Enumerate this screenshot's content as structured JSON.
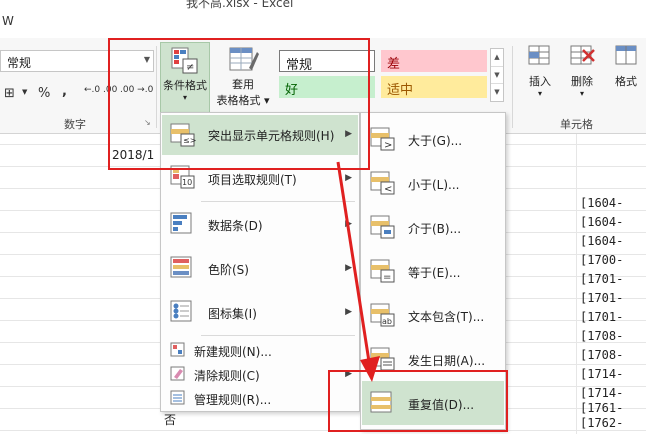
{
  "window": {
    "title_partial": "我不高.xlsx - Excel",
    "partial_tab": "W"
  },
  "ribbon": {
    "number_format_value": "常规",
    "number_buttons": {
      "percent": "%",
      "comma": ",",
      "inc_decimal": "←.0 .00",
      "dec_decimal": ".00 →.0"
    },
    "number_group_label": "数字",
    "cond_format": {
      "line1": "条件格式",
      "line2": "▾"
    },
    "table_format": {
      "line1": "套用",
      "line2": "表格格式 ▾"
    },
    "styles": {
      "normal": "常规",
      "bad": "差",
      "good": "好",
      "neutral": "适中"
    },
    "cells": {
      "insert": "插入",
      "delete": "删除",
      "format": "格式"
    },
    "cells_group_label": "单元格"
  },
  "sheet": {
    "date_cell": "2018/1",
    "zi_cell": "否",
    "codes": [
      "[1604-",
      "[1604-",
      "[1604-",
      "[1700-",
      "[1701-",
      "[1701-",
      "[1701-",
      "[1708-",
      "[1708-",
      "[1714-",
      "[1714-",
      "[1761-",
      "[1762-"
    ]
  },
  "main_menu": {
    "items": [
      {
        "label": "突出显示单元格规则(H)",
        "has_sub": true,
        "highlighted": true
      },
      {
        "label": "项目选取规则(T)",
        "has_sub": true
      },
      {
        "label": "数据条(D)",
        "has_sub": true
      },
      {
        "label": "色阶(S)",
        "has_sub": true
      },
      {
        "label": "图标集(I)",
        "has_sub": true
      },
      {
        "label": "新建规则(N)..."
      },
      {
        "label": "清除规则(C)",
        "has_sub": true
      },
      {
        "label": "管理规则(R)..."
      }
    ],
    "sub_arrow": "▶"
  },
  "sub_menu": {
    "items": [
      {
        "label": "大于(G)..."
      },
      {
        "label": "小于(L)..."
      },
      {
        "label": "介于(B)..."
      },
      {
        "label": "等于(E)..."
      },
      {
        "label": "文本包含(T)..."
      },
      {
        "label": "发生日期(A)..."
      },
      {
        "label": "重复值(D)...",
        "highlighted": true
      }
    ]
  },
  "colors": {
    "accent_green": "#cfe3cf",
    "highlight_red": "#e02020"
  }
}
